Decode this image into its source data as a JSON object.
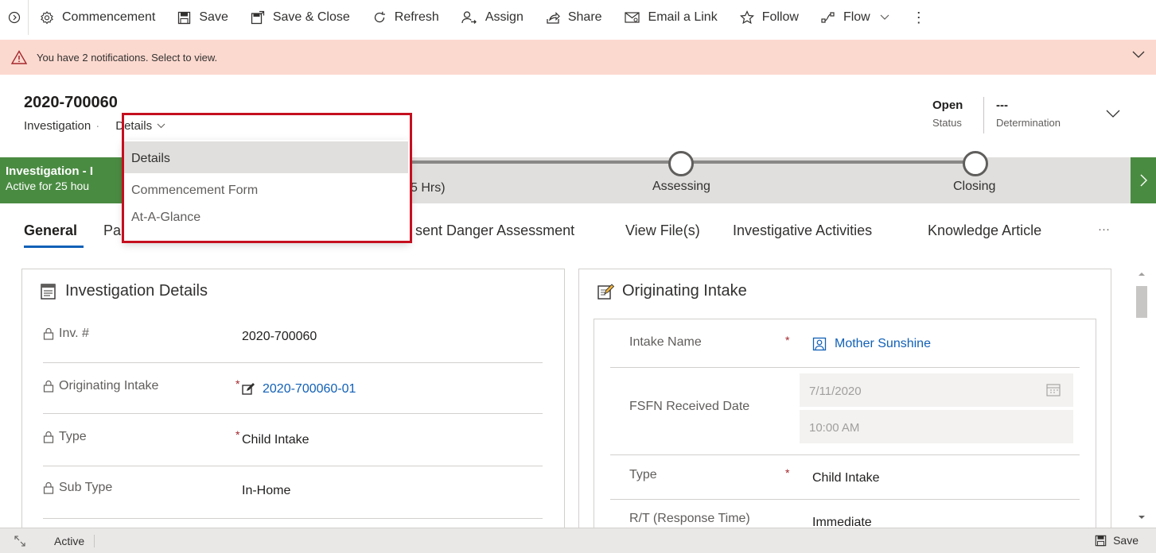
{
  "command_bar": {
    "items": [
      {
        "label": "Commencement",
        "icon": "gear-icon"
      },
      {
        "label": "Save",
        "icon": "save-icon"
      },
      {
        "label": "Save & Close",
        "icon": "save-close-icon"
      },
      {
        "label": "Refresh",
        "icon": "refresh-icon"
      },
      {
        "label": "Assign",
        "icon": "assign-icon"
      },
      {
        "label": "Share",
        "icon": "share-icon"
      },
      {
        "label": "Email a Link",
        "icon": "email-link-icon"
      },
      {
        "label": "Follow",
        "icon": "star-icon"
      },
      {
        "label": "Flow",
        "icon": "flow-icon"
      }
    ],
    "more": "⋮"
  },
  "notification": {
    "text": "You have 2 notifications. Select to view.",
    "icon": "warning-icon"
  },
  "header": {
    "record_id": "2020-700060",
    "entity": "Investigation",
    "form_selector": "Details",
    "fields": [
      {
        "value": "Open",
        "label": "Status"
      },
      {
        "value": "---",
        "label": "Determination"
      }
    ]
  },
  "bpf": {
    "active_stage_name": "Investigation - I",
    "active_duration": "Active for 25 hou",
    "hidden_text": "5 Hrs)",
    "stages": [
      "Assessing",
      "Closing"
    ]
  },
  "tabs": [
    {
      "label": "General"
    },
    {
      "label": "Pa"
    },
    {
      "label": "sent Danger Assessment"
    },
    {
      "label": "View File(s)"
    },
    {
      "label": "Investigative Activities"
    },
    {
      "label": "Knowledge Article"
    },
    {
      "label": "···"
    }
  ],
  "form_dropdown": {
    "items": [
      "Details",
      "Commencement Form",
      "At-A-Glance"
    ],
    "selected": "Details"
  },
  "investigation_details": {
    "title": "Investigation Details",
    "rows": [
      {
        "label": "Inv. #",
        "required": false,
        "value": "2020-700060",
        "link": false
      },
      {
        "label": "Originating Intake",
        "required": true,
        "value": "2020-700060-01",
        "link": true
      },
      {
        "label": "Type",
        "required": true,
        "value": "Child Intake",
        "link": false
      },
      {
        "label": "Sub Type",
        "required": false,
        "value": "In-Home",
        "link": false
      }
    ]
  },
  "originating_intake": {
    "title": "Originating Intake",
    "intake_name_label": "Intake Name",
    "intake_name_value": "Mother Sunshine",
    "received_label": "FSFN Received Date",
    "received_date": "7/11/2020",
    "received_time": "10:00 AM",
    "type_label": "Type",
    "type_value": "Child Intake",
    "rt_label": "R/T (Response Time)",
    "rt_value": "Immediate",
    "required_mark": "*"
  },
  "status_bar": {
    "status": "Active",
    "save_label": "Save"
  }
}
